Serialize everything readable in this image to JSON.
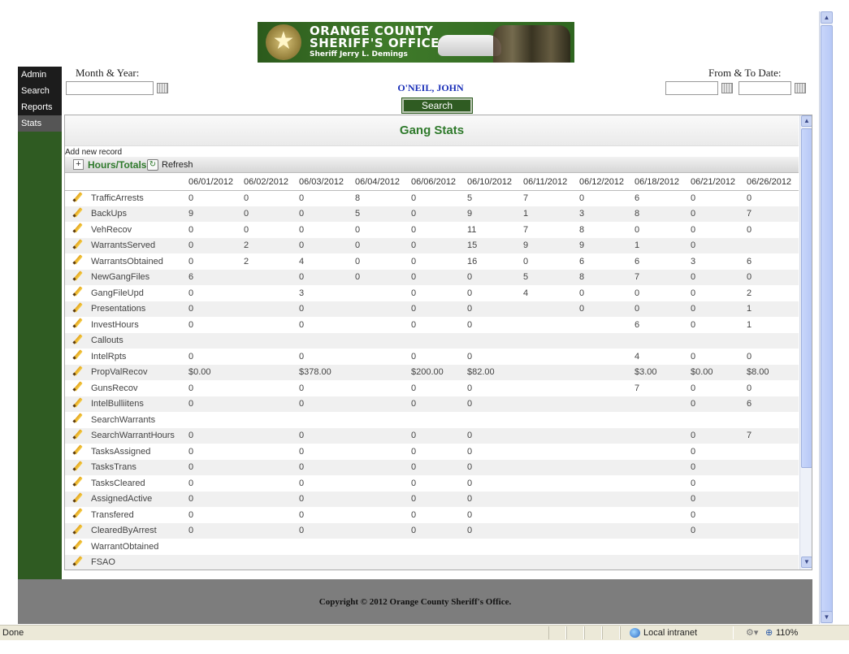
{
  "banner": {
    "line1": "ORANGE COUNTY",
    "line2": "SHERIFF'S OFFICE",
    "line3": "Sheriff Jerry L. Demings"
  },
  "nav": {
    "items": [
      {
        "label": "Admin"
      },
      {
        "label": "Search"
      },
      {
        "label": "Reports"
      },
      {
        "label": "Stats"
      }
    ]
  },
  "header": {
    "month_year_label": "Month & Year:",
    "month_year_value": "",
    "date_range_label": "From & To Date:",
    "from_value": "",
    "to_value": "",
    "officer_name": "O'NEIL, JOHN",
    "search_label": "Search"
  },
  "grid": {
    "title": "Gang Stats",
    "add_new": "Add new record",
    "group_label": "Hours/Totals",
    "refresh_label": "Refresh",
    "columns": [
      "06/01/2012",
      "06/02/2012",
      "06/03/2012",
      "06/04/2012",
      "06/06/2012",
      "06/10/2012",
      "06/11/2012",
      "06/12/2012",
      "06/18/2012",
      "06/21/2012",
      "06/26/2012"
    ],
    "rows": [
      {
        "name": "TrafficArrests",
        "values": [
          "0",
          "0",
          "0",
          "8",
          "0",
          "5",
          "7",
          "0",
          "6",
          "0",
          "0"
        ]
      },
      {
        "name": "BackUps",
        "values": [
          "9",
          "0",
          "0",
          "5",
          "0",
          "9",
          "1",
          "3",
          "8",
          "0",
          "7"
        ]
      },
      {
        "name": "VehRecov",
        "values": [
          "0",
          "0",
          "0",
          "0",
          "0",
          "11",
          "7",
          "8",
          "0",
          "0",
          "0"
        ]
      },
      {
        "name": "WarrantsServed",
        "values": [
          "0",
          "2",
          "0",
          "0",
          "0",
          "15",
          "9",
          "9",
          "1",
          "0",
          ""
        ]
      },
      {
        "name": "WarrantsObtained",
        "values": [
          "0",
          "2",
          "4",
          "0",
          "0",
          "16",
          "0",
          "6",
          "6",
          "3",
          "6"
        ]
      },
      {
        "name": "NewGangFiles",
        "values": [
          "6",
          "",
          "0",
          "0",
          "0",
          "0",
          "5",
          "8",
          "7",
          "0",
          "0"
        ]
      },
      {
        "name": "GangFileUpd",
        "values": [
          "0",
          "",
          "3",
          "",
          "0",
          "0",
          "4",
          "0",
          "0",
          "0",
          "2"
        ]
      },
      {
        "name": "Presentations",
        "values": [
          "0",
          "",
          "0",
          "",
          "0",
          "0",
          "",
          "0",
          "0",
          "0",
          "1"
        ]
      },
      {
        "name": "InvestHours",
        "values": [
          "0",
          "",
          "0",
          "",
          "0",
          "0",
          "",
          "",
          "6",
          "0",
          "1"
        ]
      },
      {
        "name": "Callouts",
        "values": [
          "",
          "",
          "",
          "",
          "",
          "",
          "",
          "",
          "",
          "",
          ""
        ]
      },
      {
        "name": "IntelRpts",
        "values": [
          "0",
          "",
          "0",
          "",
          "0",
          "0",
          "",
          "",
          "4",
          "0",
          "0"
        ]
      },
      {
        "name": "PropValRecov",
        "values": [
          "$0.00",
          "",
          "$378.00",
          "",
          "$200.00",
          "$82.00",
          "",
          "",
          "$3.00",
          "$0.00",
          "$8.00"
        ]
      },
      {
        "name": "GunsRecov",
        "values": [
          "0",
          "",
          "0",
          "",
          "0",
          "0",
          "",
          "",
          "7",
          "0",
          "0"
        ]
      },
      {
        "name": "IntelBulliitens",
        "values": [
          "0",
          "",
          "0",
          "",
          "0",
          "0",
          "",
          "",
          "",
          "0",
          "6"
        ]
      },
      {
        "name": "SearchWarrants",
        "values": [
          "",
          "",
          "",
          "",
          "",
          "",
          "",
          "",
          "",
          "",
          ""
        ]
      },
      {
        "name": "SearchWarrantHours",
        "values": [
          "0",
          "",
          "0",
          "",
          "0",
          "0",
          "",
          "",
          "",
          "0",
          "7"
        ]
      },
      {
        "name": "TasksAssigned",
        "values": [
          "0",
          "",
          "0",
          "",
          "0",
          "0",
          "",
          "",
          "",
          "0",
          ""
        ]
      },
      {
        "name": "TasksTrans",
        "values": [
          "0",
          "",
          "0",
          "",
          "0",
          "0",
          "",
          "",
          "",
          "0",
          ""
        ]
      },
      {
        "name": "TasksCleared",
        "values": [
          "0",
          "",
          "0",
          "",
          "0",
          "0",
          "",
          "",
          "",
          "0",
          ""
        ]
      },
      {
        "name": "AssignedActive",
        "values": [
          "0",
          "",
          "0",
          "",
          "0",
          "0",
          "",
          "",
          "",
          "0",
          ""
        ]
      },
      {
        "name": "Transfered",
        "values": [
          "0",
          "",
          "0",
          "",
          "0",
          "0",
          "",
          "",
          "",
          "0",
          ""
        ]
      },
      {
        "name": "ClearedByArrest",
        "values": [
          "0",
          "",
          "0",
          "",
          "0",
          "0",
          "",
          "",
          "",
          "0",
          ""
        ]
      },
      {
        "name": "WarrantObtained",
        "values": [
          "",
          "",
          "",
          "",
          "",
          "",
          "",
          "",
          "",
          "",
          ""
        ]
      },
      {
        "name": "FSAO",
        "values": [
          "",
          "",
          "",
          "",
          "",
          "",
          "",
          "",
          "",
          "",
          ""
        ]
      }
    ]
  },
  "footer": {
    "copyright": "Copyright © 2012 Orange County Sheriff's Office."
  },
  "statusbar": {
    "status": "Done",
    "zone": "Local intranet",
    "zoom": "110%"
  }
}
